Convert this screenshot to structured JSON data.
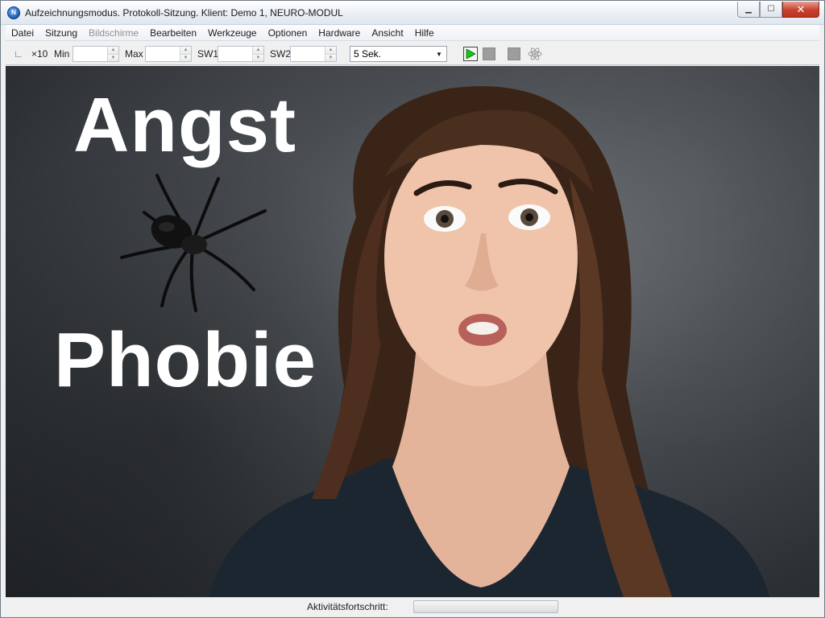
{
  "window": {
    "title": "Aufzeichnungsmodus. Protokoll-Sitzung. Klient: Demo 1, NEURO-MODUL",
    "app_icon_text": "N",
    "minimize_glyph": "▁",
    "maximize_glyph": "☐",
    "close_glyph": "✕"
  },
  "menu": {
    "items": [
      {
        "label": "Datei",
        "disabled": false
      },
      {
        "label": "Sitzung",
        "disabled": false
      },
      {
        "label": "Bildschirme",
        "disabled": true
      },
      {
        "label": "Bearbeiten",
        "disabled": false
      },
      {
        "label": "Werkzeuge",
        "disabled": false
      },
      {
        "label": "Optionen",
        "disabled": false
      },
      {
        "label": "Hardware",
        "disabled": false
      },
      {
        "label": "Ansicht",
        "disabled": false
      },
      {
        "label": "Hilfe",
        "disabled": false
      }
    ]
  },
  "toolbar": {
    "axis_glyph": "∟",
    "x10_label": "×10",
    "min_label": "Min",
    "min_value": "",
    "max_label": "Max",
    "max_value": "",
    "sw1_label": "SW1",
    "sw1_value": "",
    "sw2_label": "SW2",
    "sw2_value": "",
    "interval_value": "5 Sek.",
    "colors": {
      "play": "#19c419",
      "stop": "#9d9d9d"
    }
  },
  "canvas": {
    "headline_top": "Angst",
    "headline_bottom": "Phobie"
  },
  "status": {
    "activity_label": "Aktivitätsfortschritt:",
    "progress_fraction": 0
  }
}
